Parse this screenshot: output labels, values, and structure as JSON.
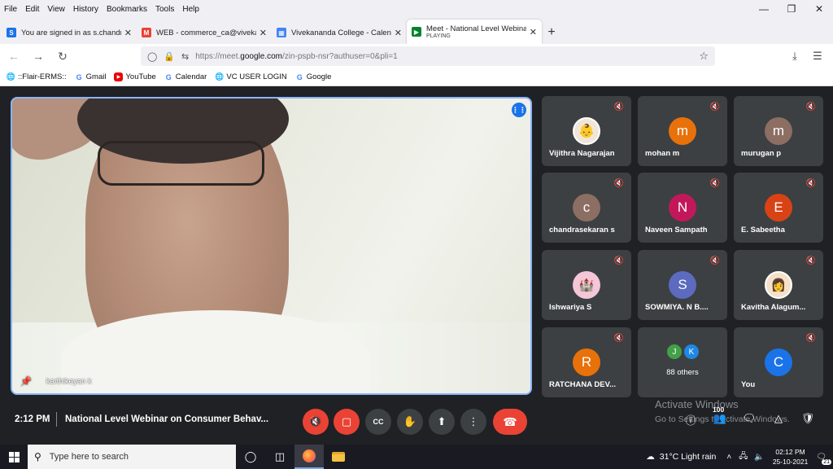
{
  "menu": [
    "File",
    "Edit",
    "View",
    "History",
    "Bookmarks",
    "Tools",
    "Help"
  ],
  "tabs": [
    {
      "title": "You are signed in as s.chandrasekaran",
      "fav_color": "#1a73e8",
      "fav": "S"
    },
    {
      "title": "WEB - commerce_ca@vivekanandacollege",
      "fav_color": "#ea4335",
      "fav": "M"
    },
    {
      "title": "Vivekananda College - Calendar",
      "fav_color": "#4285f4",
      "fav": "31"
    },
    {
      "title": "Meet - National Level Webinar on Consumer",
      "sub": "PLAYING",
      "fav_color": "#00832d",
      "fav": "▶"
    }
  ],
  "url": {
    "prefix": "https://meet.",
    "domain": "google.com",
    "suffix": "/zin-pspb-nsr?authuser=0&pli=1"
  },
  "bookmarks": [
    {
      "label": "::Flair-ERMS::",
      "icon": "globe"
    },
    {
      "label": "Gmail",
      "icon": "google"
    },
    {
      "label": "YouTube",
      "icon": "youtube"
    },
    {
      "label": "Calendar",
      "icon": "google"
    },
    {
      "label": "VC USER LOGIN",
      "icon": "globe"
    },
    {
      "label": "Google",
      "icon": "google"
    }
  ],
  "main_video": {
    "name": "karthikeyan k"
  },
  "participants": [
    {
      "name": "Vijithra Nagarajan",
      "initial": "",
      "color": "#f0e6d8",
      "photo": true
    },
    {
      "name": "mohan m",
      "initial": "m",
      "color": "#e8710a"
    },
    {
      "name": "murugan p",
      "initial": "m",
      "color": "#8d6e63"
    },
    {
      "name": "chandrasekaran s",
      "initial": "c",
      "color": "#8d6e63"
    },
    {
      "name": "Naveen Sampath",
      "initial": "N",
      "color": "#c2185b"
    },
    {
      "name": "E. Sabeetha",
      "initial": "E",
      "color": "#d84315"
    },
    {
      "name": "Ishwariya S",
      "initial": "",
      "color": "#f3c6d8",
      "photo": true
    },
    {
      "name": "SOWMIYA. N B....",
      "initial": "S",
      "color": "#5c6bc0"
    },
    {
      "name": "Kavitha Alagum...",
      "initial": "",
      "color": "#f5e0c8",
      "photo": true
    },
    {
      "name": "RATCHANA DEV...",
      "initial": "R",
      "color": "#e8710a"
    },
    {
      "name": "",
      "others_label": "88 others",
      "mini": [
        {
          "initial": "J",
          "color": "#43a047"
        },
        {
          "initial": "K",
          "color": "#1e88e5"
        }
      ]
    },
    {
      "name": "You",
      "initial": "C",
      "color": "#1a73e8"
    }
  ],
  "meeting": {
    "time": "2:12 PM",
    "title": "National Level Webinar on Consumer Behav...",
    "participant_count": "100"
  },
  "watermark": {
    "line1": "Activate Windows",
    "line2": "Go to Settings to activate Windows."
  },
  "taskbar": {
    "search_placeholder": "Type here to search",
    "weather": "31°C  Light rain",
    "time": "02:12 PM",
    "date": "25-10-2021",
    "notif_count": "21"
  }
}
